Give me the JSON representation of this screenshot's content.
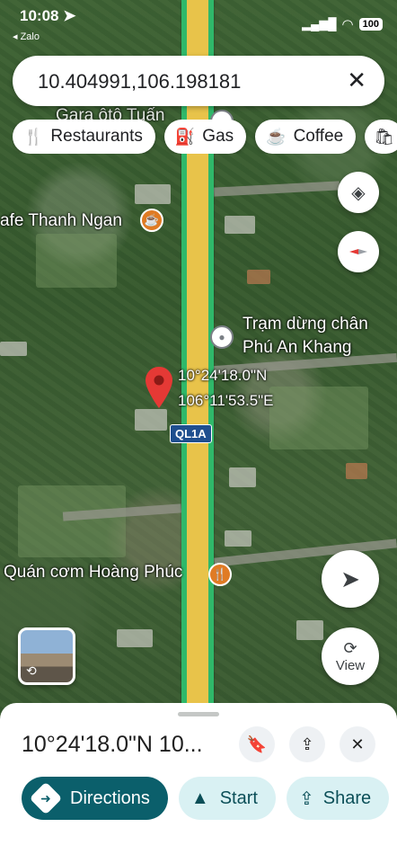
{
  "status_bar": {
    "time": "10:08",
    "back_app": "◂ Zalo",
    "battery": "100"
  },
  "search": {
    "value": "10.404991,106.198181"
  },
  "chips": [
    {
      "icon": "restaurant-icon",
      "label": "Restaurants"
    },
    {
      "icon": "gas-station-icon",
      "label": "Gas"
    },
    {
      "icon": "coffee-icon",
      "label": "Coffee"
    }
  ],
  "map": {
    "labels": {
      "top_partial": "Gara ôtô Tuấn",
      "cafe": "afe Thanh Ngan",
      "rest_stop_line1": "Trạm dừng chân",
      "rest_stop_line2": "Phú An Khang",
      "pin_lat": "10°24'18.0\"N",
      "pin_lng": "106°11'53.5\"E",
      "restaurant": "Quán cơm Hoàng Phúc",
      "road_shield": "QL1A"
    },
    "street_view_label": "View"
  },
  "sheet": {
    "title": "10°24'18.0\"N 10...",
    "actions": [
      {
        "label": "Directions",
        "icon": "directions-icon"
      },
      {
        "label": "Start",
        "icon": "navigation-arrow-icon"
      },
      {
        "label": "Share",
        "icon": "share-icon"
      }
    ]
  },
  "colors": {
    "primary_action": "#0b5f6b",
    "secondary_action": "#d9f1f3",
    "pin": "#e53935",
    "highway": "#e8c34a"
  }
}
